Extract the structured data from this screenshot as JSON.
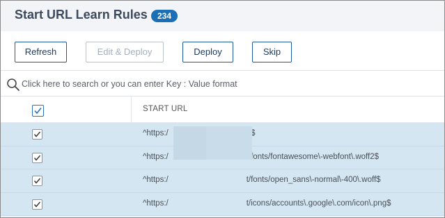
{
  "header": {
    "title": "Start URL Learn Rules",
    "count": "234"
  },
  "toolbar": {
    "refresh": "Refresh",
    "edit_deploy": "Edit & Deploy",
    "deploy": "Deploy",
    "skip": "Skip"
  },
  "search": {
    "placeholder": "Click here to search or you can enter Key : Value format"
  },
  "table": {
    "column": "START URL",
    "rows": [
      {
        "prefix": "^https:/",
        "suffix": "t/$"
      },
      {
        "prefix": "^https:/",
        "suffix": "t/fonts/fontawesome\\-webfont\\.woff2$"
      },
      {
        "prefix": "^https:/",
        "suffix": "t/fonts/open_sans\\-normal\\-400\\.woff$"
      },
      {
        "prefix": "^https:/",
        "suffix": "t/icons/accounts\\.google\\.com/icon\\.png$"
      }
    ]
  },
  "colors": {
    "accent": "#1b6fb6",
    "selected_row": "#d3e6f2"
  }
}
